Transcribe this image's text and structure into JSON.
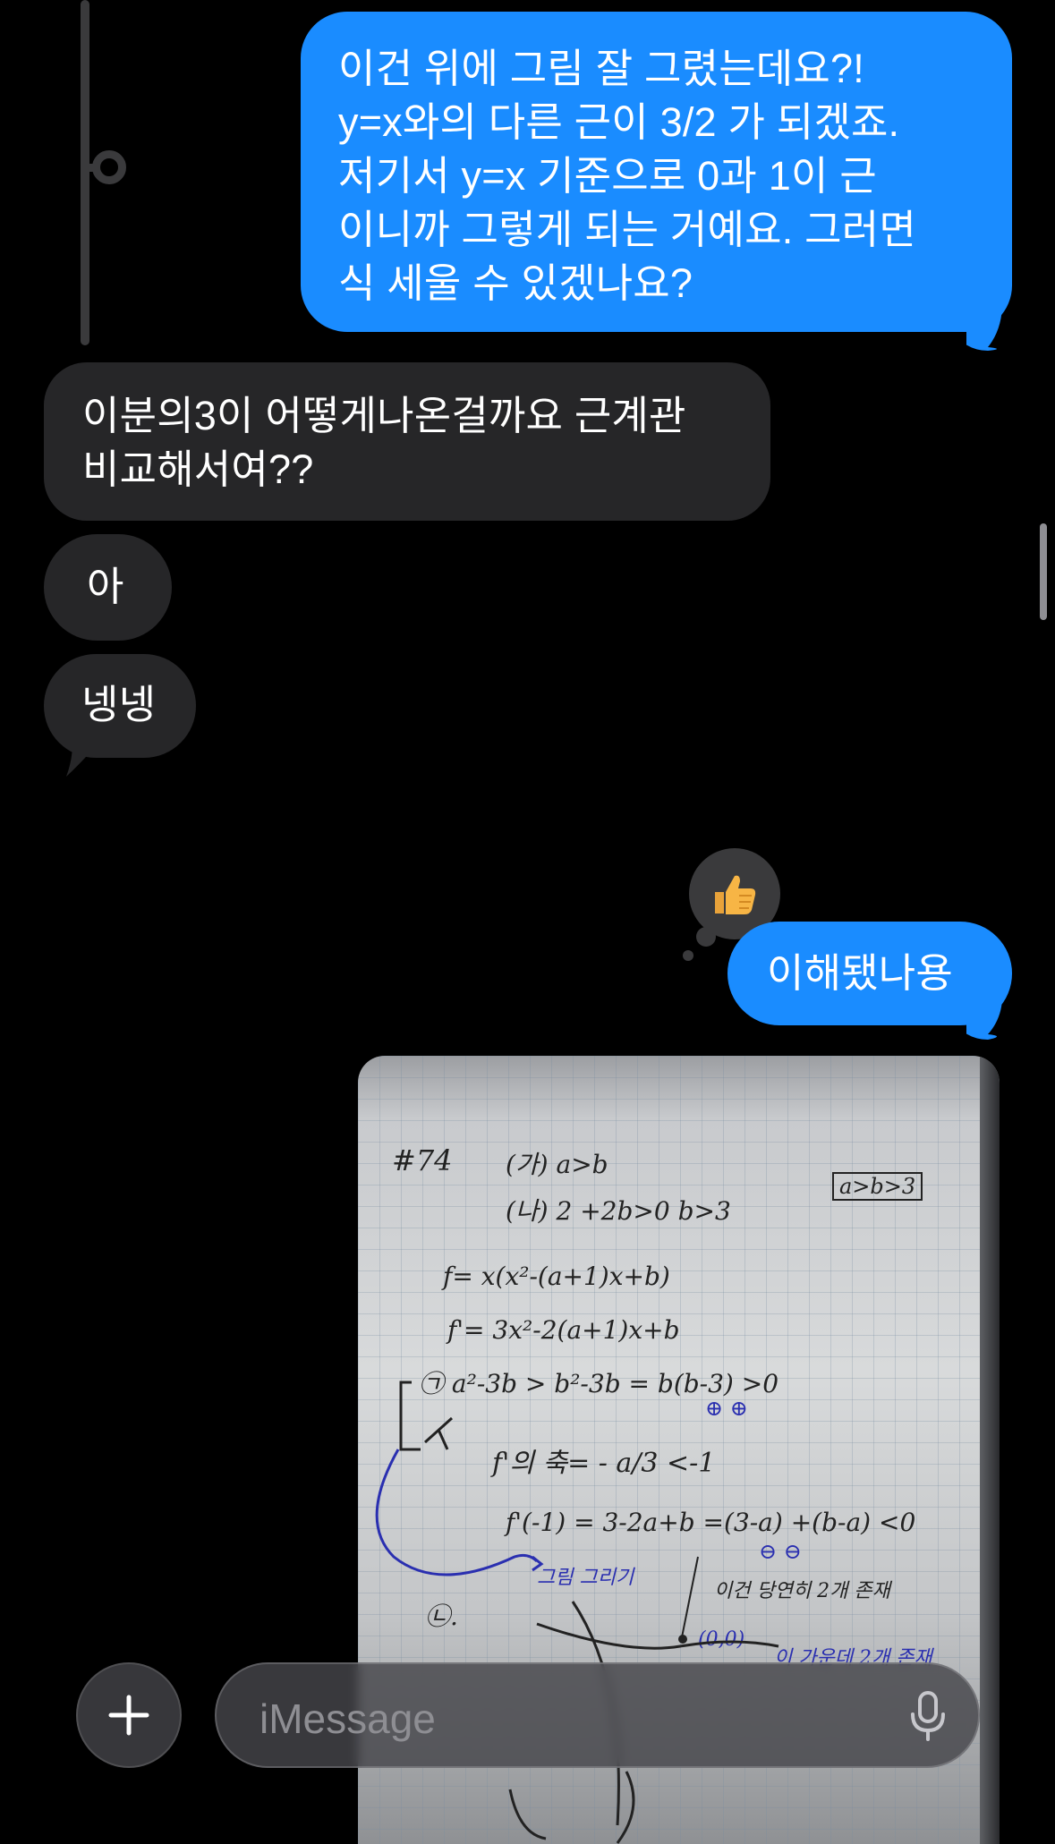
{
  "messages": [
    {
      "direction": "outgoing",
      "lines": [
        "이건 위에 그림 잘 그렸는데요?!",
        "y=x와의 다른 근이 3/2 가 되겠죠.",
        "저기서 y=x 기준으로 0과 1이 근",
        "이니까 그렇게 되는 거예요. 그러면",
        "식 세울 수 있겠나요?"
      ]
    },
    {
      "direction": "incoming",
      "lines": [
        "이분의3이 어떻게나온걸까요 근계관",
        "비교해서여??"
      ]
    },
    {
      "direction": "incoming",
      "lines": [
        "아"
      ]
    },
    {
      "direction": "incoming",
      "lines": [
        "넹넹"
      ]
    },
    {
      "direction": "outgoing",
      "lines": [
        "이해됐나용"
      ],
      "tapback": "👍"
    }
  ],
  "photo": {
    "notes": {
      "title": "#74",
      "ga": "(가) a>b",
      "na": "(나) 2 +2b>0   b>3",
      "box": "a>b>3",
      "f": "f= x(x²-(a+1)x+b)",
      "fprime": "f'= 3x²-2(a+1)x+b",
      "c1": "㉠ a²-3b > b²-3b = b(b-3) >0",
      "c1signs": "⊕  ⊕",
      "c2": "f'의 축= - a/3 <-1",
      "c3": "f'(-1) = 3-2a+b =(3-a) +(b-a) <0",
      "c3signs": "⊖        ⊖",
      "graph": "그림 그리기",
      "note1": "이건 당연히 2개 존재",
      "c4": "㉡.",
      "point": "(0,0)",
      "note2": "이 가운데 2개 존재"
    }
  },
  "composer": {
    "placeholder": "iMessage",
    "plus": "+"
  },
  "colors": {
    "outgoing": "#1a8cff",
    "incoming": "#262628",
    "background": "#000000"
  }
}
